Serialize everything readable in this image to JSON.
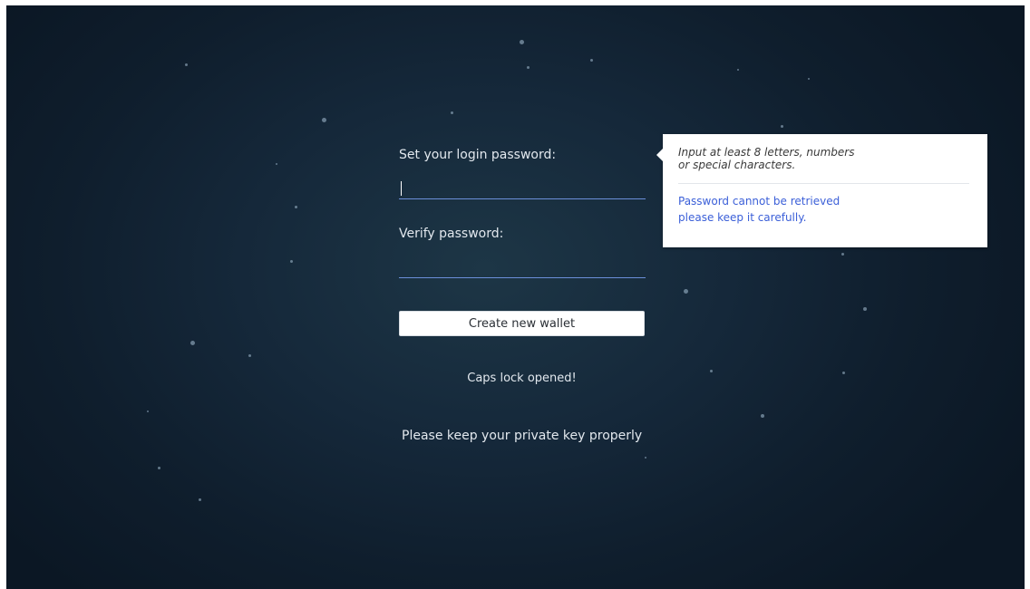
{
  "form": {
    "password_label": "Set your login password:",
    "password_value": "",
    "verify_label": "Verify password:",
    "verify_value": "",
    "create_button_label": "Create new wallet",
    "caps_lock_message": "Caps lock opened!",
    "private_key_notice": "Please keep your private key properly"
  },
  "tooltip": {
    "hint_line1": "Input at least 8 letters, numbers",
    "hint_line2": "or special characters.",
    "warning_line1": "Password cannot be retrieved",
    "warning_line2": "please keep it carefully."
  },
  "colors": {
    "background": "#132535",
    "input_underline": "#6b8fd9",
    "warning_text": "#3b5fd8",
    "label_text": "#e2e8ee"
  }
}
